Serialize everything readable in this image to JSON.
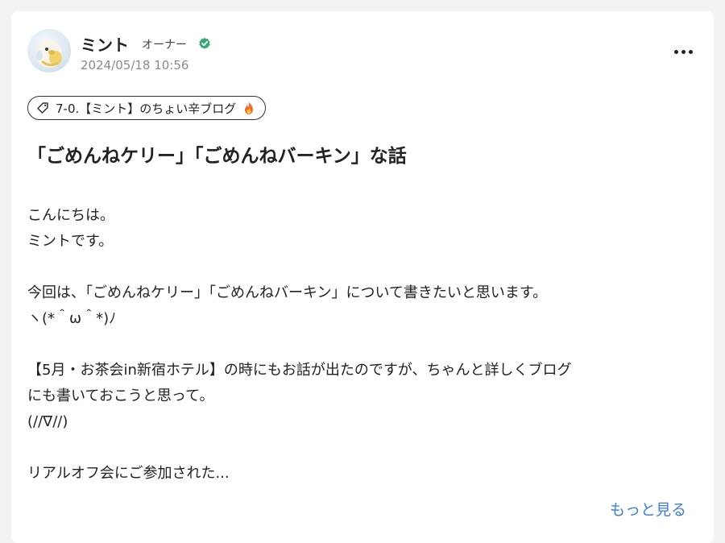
{
  "author": {
    "name": "ミント",
    "role": "オーナー",
    "timestamp": "2024/05/18 10:56"
  },
  "tag": {
    "label": "7-0.【ミント】のちょい辛ブログ"
  },
  "post": {
    "title": "「ごめんねケリー」「ごめんねバーキン」な話",
    "body": {
      "line1": "こんにちは。",
      "line2": "ミントです。",
      "line3": "今回は、「ごめんねケリー」「ごめんねバーキン」について書きたいと思います。",
      "line4": "ヽ(*＾ω＾*)ﾉ",
      "line5": "【5月・お茶会in新宿ホテル】の時にもお話が出たのですが、ちゃんと詳しくブログ",
      "line6": "にも書いておこうと思って。",
      "line7": "(//∇//)",
      "line8": "リアルオフ会にご参加された..."
    },
    "see_more": "もっと見る"
  },
  "colors": {
    "link": "#3d7fcf",
    "verified": "#3aa676",
    "text": "#222222",
    "muted": "#8a8a8a"
  },
  "icons": {
    "verified": "verified-check-icon",
    "more": "more-horizontal-icon",
    "tag": "tag-icon",
    "flame": "fire-emoji-icon"
  }
}
